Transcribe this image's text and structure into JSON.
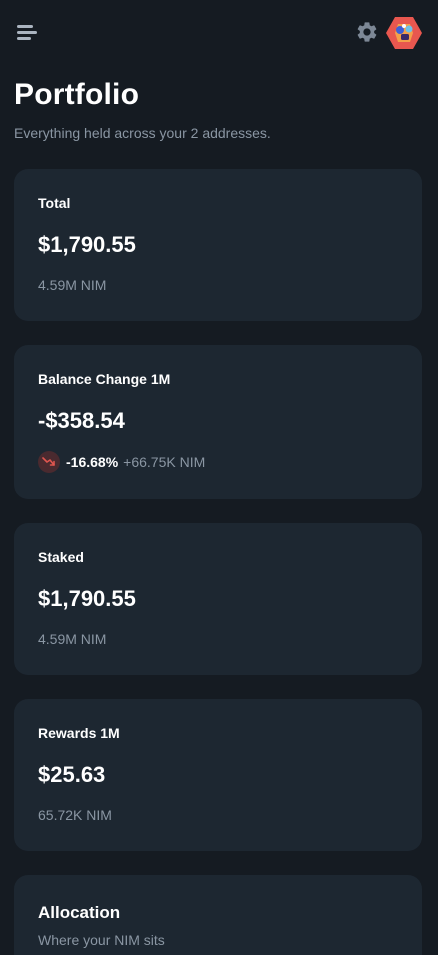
{
  "header": {
    "menu_icon": "menu-icon",
    "settings_icon": "gear-icon",
    "avatar_icon": "identicon-avatar"
  },
  "page": {
    "title": "Portfolio",
    "subtitle": "Everything held across your 2 addresses."
  },
  "cards": {
    "total": {
      "label": "Total",
      "value": "$1,790.55",
      "sub": "4.59M NIM"
    },
    "balance_change": {
      "label": "Balance Change 1M",
      "value": "-$358.54",
      "percent": "-16.68%",
      "nim_change": "+66.75K NIM",
      "trend_icon": "trend-down-icon",
      "trend_color": "#e0564f"
    },
    "staked": {
      "label": "Staked",
      "value": "$1,790.55",
      "sub": "4.59M NIM"
    },
    "rewards": {
      "label": "Rewards 1M",
      "value": "$25.63",
      "sub": "65.72K NIM"
    },
    "allocation": {
      "title": "Allocation",
      "subtitle": "Where your NIM sits"
    }
  },
  "colors": {
    "background": "#151b22",
    "card": "#1d2731",
    "muted_text": "#8a96a3",
    "negative": "#e0564f"
  }
}
